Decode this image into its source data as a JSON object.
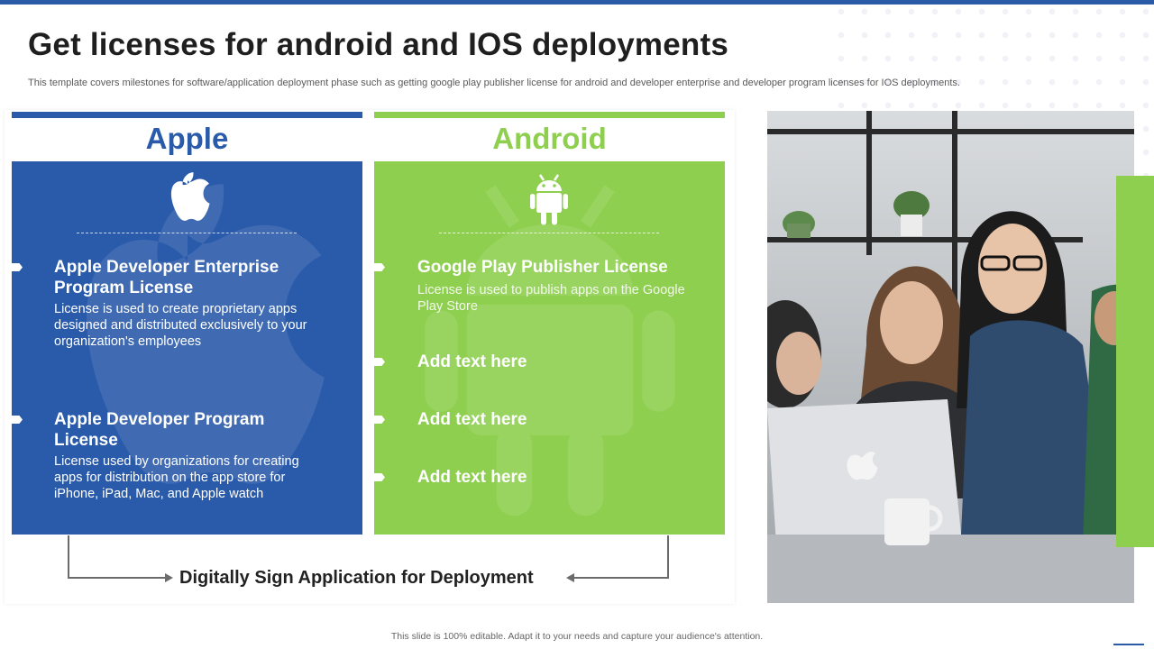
{
  "slide": {
    "title": "Get licenses for android and IOS deployments",
    "subtitle": "This template covers milestones for software/application deployment phase such as getting google play publisher license for android and developer enterprise and developer program licenses for IOS  deployments.",
    "footer": "This slide is 100% editable.  Adapt it to your needs and capture your audience's attention."
  },
  "colors": {
    "brand_blue": "#2b5aa6",
    "apple_blue": "#2a5aaa",
    "android_green": "#8ecf4f"
  },
  "apple": {
    "heading": "Apple",
    "icon": "apple-logo-icon",
    "items": [
      {
        "title": "Apple Developer Enterprise Program License",
        "body": "License is used to create proprietary  apps designed and distributed exclusively to your organization's employees"
      },
      {
        "title": "Apple Developer Program License",
        "body": "License used by  organizations for creating apps for distribution on the  app store for iPhone, iPad, Mac, and Apple watch"
      }
    ]
  },
  "android": {
    "heading": "Android",
    "icon": "android-robot-icon",
    "items": [
      {
        "title": "Google Play Publisher License",
        "body": "License is used to publish apps on the Google Play Store"
      },
      {
        "title": "Add text here"
      },
      {
        "title": "Add text here"
      },
      {
        "title": "Add text here"
      }
    ]
  },
  "connector": {
    "label": "Digitally  Sign Application  for  Deployment"
  },
  "photo": {
    "description_icon": "team-at-laptop-photo"
  }
}
